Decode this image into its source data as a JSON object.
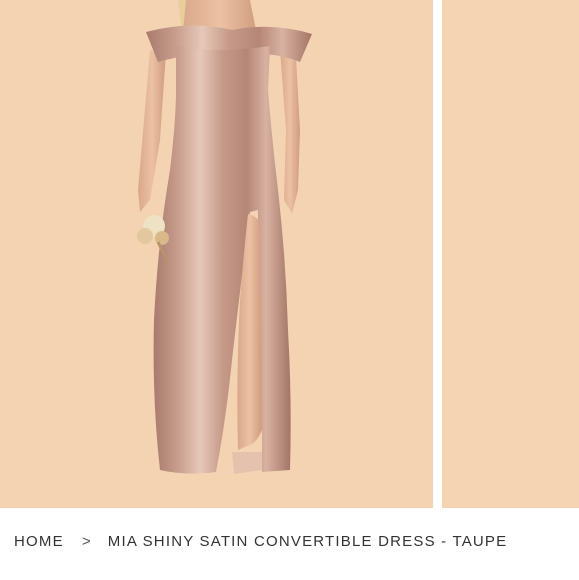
{
  "breadcrumb": {
    "home_label": "HOME",
    "separator": ">",
    "current_label": "MIA SHINY SATIN CONVERTIBLE DRESS - TAUPE"
  },
  "gallery": {
    "background_color": "#f4d3b3",
    "dress_color": "#c79a8a"
  }
}
